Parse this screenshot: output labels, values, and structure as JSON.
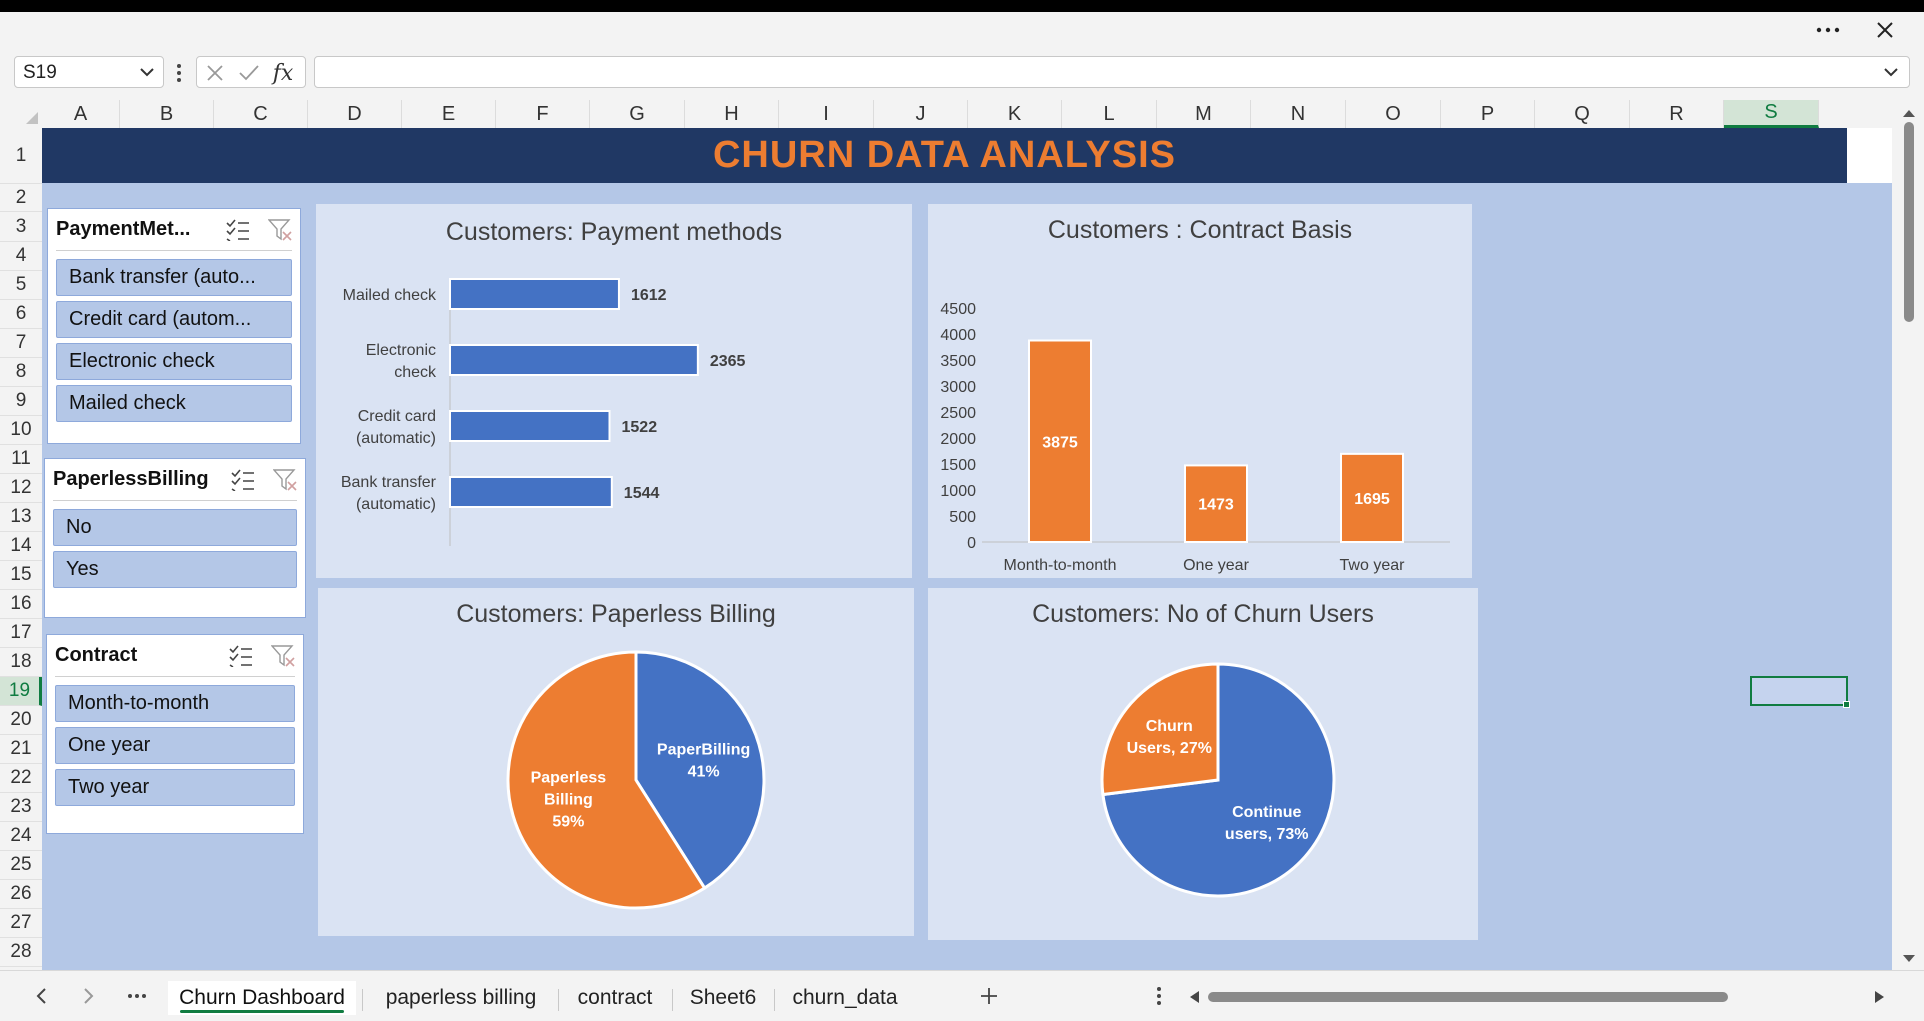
{
  "window": {
    "more_icon": "ellipsis-icon",
    "close_icon": "close-icon"
  },
  "formula_bar": {
    "name_box": "S19",
    "fx_label": "fx",
    "formula": ""
  },
  "columns": [
    "A",
    "B",
    "C",
    "D",
    "E",
    "F",
    "G",
    "H",
    "I",
    "J",
    "K",
    "L",
    "M",
    "N",
    "O",
    "P",
    "Q",
    "R",
    "S"
  ],
  "selected_column": "S",
  "rows": [
    "1",
    "2",
    "3",
    "4",
    "5",
    "6",
    "7",
    "8",
    "9",
    "10",
    "11",
    "12",
    "13",
    "14",
    "15",
    "16",
    "17",
    "18",
    "19",
    "20",
    "21",
    "22",
    "23",
    "24",
    "25",
    "26",
    "27",
    "28"
  ],
  "selected_row": "19",
  "sheet": {
    "banner_title": "CHURN DATA ANALYSIS"
  },
  "slicers": {
    "payment": {
      "title": "PaymentMet...",
      "items": [
        "Bank transfer (auto...",
        "Credit card (autom...",
        "Electronic check",
        "Mailed check"
      ]
    },
    "paperless": {
      "title": "PaperlessBilling",
      "items": [
        "No",
        "Yes"
      ]
    },
    "contract": {
      "title": "Contract",
      "items": [
        "Month-to-month",
        "One year",
        "Two year"
      ]
    }
  },
  "colors": {
    "blue": "#4472c4",
    "orange": "#ed7d31",
    "banner": "#203864",
    "sheet_bg": "#b4c7e7",
    "chart_bg": "#dae3f3",
    "excel_green": "#107c41"
  },
  "chart_data": [
    {
      "type": "bar",
      "orientation": "horizontal",
      "title": "Customers: Payment methods",
      "categories": [
        "Mailed check",
        "Electronic check",
        "Credit card (automatic)",
        "Bank transfer (automatic)"
      ],
      "category_lines": [
        [
          "Mailed check"
        ],
        [
          "Electronic",
          "check"
        ],
        [
          "Credit card",
          "(automatic)"
        ],
        [
          "Bank transfer",
          "(automatic)"
        ]
      ],
      "values": [
        1612,
        2365,
        1522,
        1544
      ],
      "color": "#4472c4",
      "data_labels": true,
      "xlim": [
        0,
        2500
      ]
    },
    {
      "type": "bar",
      "orientation": "vertical",
      "title": "Customers : Contract Basis",
      "categories": [
        "Month-to-month",
        "One year",
        "Two year"
      ],
      "values": [
        3875,
        1473,
        1695
      ],
      "color": "#ed7d31",
      "data_labels": true,
      "ylim": [
        0,
        4500
      ],
      "yticks": [
        0,
        500,
        1000,
        1500,
        2000,
        2500,
        3000,
        3500,
        4000,
        4500
      ]
    },
    {
      "type": "pie",
      "title": "Customers: Paperless Billing",
      "slices": [
        {
          "label_lines": [
            "PaperBilling",
            "41%"
          ],
          "value": 41,
          "color": "#4472c4"
        },
        {
          "label_lines": [
            "Paperless",
            "Billing",
            "59%"
          ],
          "value": 59,
          "color": "#ed7d31"
        }
      ]
    },
    {
      "type": "pie",
      "title": "Customers: No of Churn Users",
      "slices": [
        {
          "label_lines": [
            "Continue",
            "users,  73%"
          ],
          "value": 73,
          "color": "#4472c4"
        },
        {
          "label_lines": [
            "Churn",
            "Users, 27%"
          ],
          "value": 27,
          "color": "#ed7d31"
        }
      ]
    }
  ],
  "tabs": {
    "items": [
      "Churn Dashboard",
      "paperless billing",
      "contract",
      "Sheet6",
      "churn_data"
    ],
    "active": 0,
    "add_icon": "plus-icon",
    "more_icon": "ellipsis-icon"
  }
}
